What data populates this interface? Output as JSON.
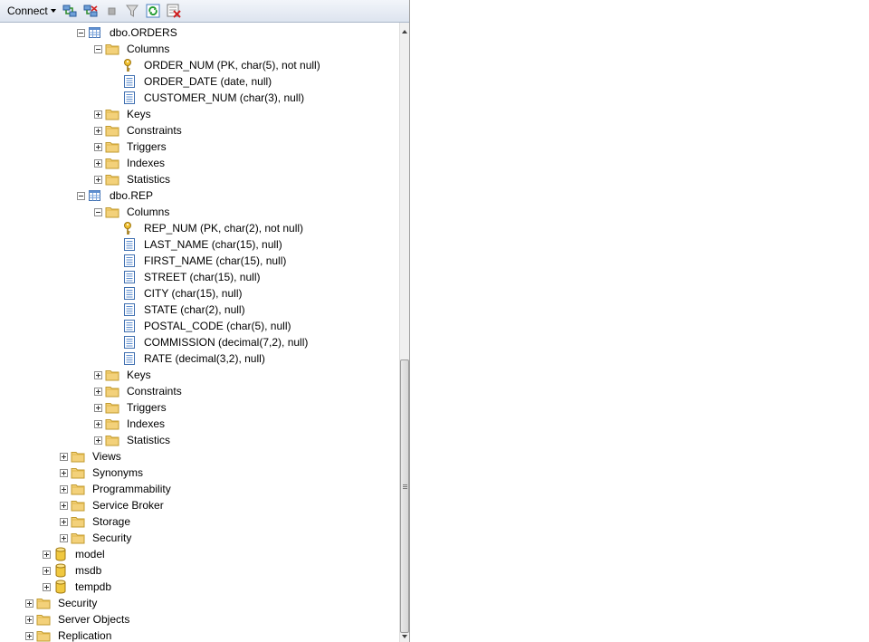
{
  "toolbar": {
    "connect_label": "Connect",
    "icons": [
      "connect-object-explorer-icon",
      "disconnect-icon",
      "stop-icon",
      "filter-icon",
      "refresh-icon",
      "close-connection-icon"
    ]
  },
  "tree": [
    {
      "label": "dbo.ORDERS",
      "icon": "table",
      "level": 4,
      "expander": "minus"
    },
    {
      "label": "Columns",
      "icon": "folder",
      "level": 5,
      "expander": "minus"
    },
    {
      "label": "ORDER_NUM (PK, char(5), not null)",
      "icon": "key",
      "level": 6,
      "expander": "none"
    },
    {
      "label": "ORDER_DATE (date, null)",
      "icon": "column",
      "level": 6,
      "expander": "none"
    },
    {
      "label": "CUSTOMER_NUM (char(3), null)",
      "icon": "column",
      "level": 6,
      "expander": "none"
    },
    {
      "label": "Keys",
      "icon": "folder",
      "level": 5,
      "expander": "plus"
    },
    {
      "label": "Constraints",
      "icon": "folder",
      "level": 5,
      "expander": "plus"
    },
    {
      "label": "Triggers",
      "icon": "folder",
      "level": 5,
      "expander": "plus"
    },
    {
      "label": "Indexes",
      "icon": "folder",
      "level": 5,
      "expander": "plus"
    },
    {
      "label": "Statistics",
      "icon": "folder",
      "level": 5,
      "expander": "plus"
    },
    {
      "label": "dbo.REP",
      "icon": "table",
      "level": 4,
      "expander": "minus"
    },
    {
      "label": "Columns",
      "icon": "folder",
      "level": 5,
      "expander": "minus"
    },
    {
      "label": "REP_NUM (PK, char(2), not null)",
      "icon": "key",
      "level": 6,
      "expander": "none"
    },
    {
      "label": "LAST_NAME (char(15), null)",
      "icon": "column",
      "level": 6,
      "expander": "none"
    },
    {
      "label": "FIRST_NAME (char(15), null)",
      "icon": "column",
      "level": 6,
      "expander": "none"
    },
    {
      "label": "STREET (char(15), null)",
      "icon": "column",
      "level": 6,
      "expander": "none"
    },
    {
      "label": "CITY (char(15), null)",
      "icon": "column",
      "level": 6,
      "expander": "none"
    },
    {
      "label": "STATE (char(2), null)",
      "icon": "column",
      "level": 6,
      "expander": "none"
    },
    {
      "label": "POSTAL_CODE (char(5), null)",
      "icon": "column",
      "level": 6,
      "expander": "none"
    },
    {
      "label": "COMMISSION (decimal(7,2), null)",
      "icon": "column",
      "level": 6,
      "expander": "none"
    },
    {
      "label": "RATE (decimal(3,2), null)",
      "icon": "column",
      "level": 6,
      "expander": "none"
    },
    {
      "label": "Keys",
      "icon": "folder",
      "level": 5,
      "expander": "plus"
    },
    {
      "label": "Constraints",
      "icon": "folder",
      "level": 5,
      "expander": "plus"
    },
    {
      "label": "Triggers",
      "icon": "folder",
      "level": 5,
      "expander": "plus"
    },
    {
      "label": "Indexes",
      "icon": "folder",
      "level": 5,
      "expander": "plus"
    },
    {
      "label": "Statistics",
      "icon": "folder",
      "level": 5,
      "expander": "plus"
    },
    {
      "label": "Views",
      "icon": "folder",
      "level": 3,
      "expander": "plus"
    },
    {
      "label": "Synonyms",
      "icon": "folder",
      "level": 3,
      "expander": "plus"
    },
    {
      "label": "Programmability",
      "icon": "folder",
      "level": 3,
      "expander": "plus"
    },
    {
      "label": "Service Broker",
      "icon": "folder",
      "level": 3,
      "expander": "plus"
    },
    {
      "label": "Storage",
      "icon": "folder",
      "level": 3,
      "expander": "plus"
    },
    {
      "label": "Security",
      "icon": "folder",
      "level": 3,
      "expander": "plus"
    },
    {
      "label": "model",
      "icon": "database",
      "level": 2,
      "expander": "plus"
    },
    {
      "label": "msdb",
      "icon": "database",
      "level": 2,
      "expander": "plus"
    },
    {
      "label": "tempdb",
      "icon": "database",
      "level": 2,
      "expander": "plus"
    },
    {
      "label": "Security",
      "icon": "folder",
      "level": 1,
      "expander": "plus"
    },
    {
      "label": "Server Objects",
      "icon": "folder",
      "level": 1,
      "expander": "plus"
    },
    {
      "label": "Replication",
      "icon": "folder",
      "level": 1,
      "expander": "plus"
    }
  ]
}
